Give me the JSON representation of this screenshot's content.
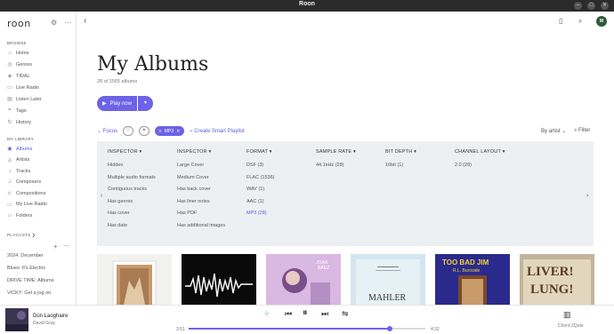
{
  "window": {
    "title": "Roon"
  },
  "sidebar": {
    "logo": "roon",
    "browse_label": "BROWSE",
    "browse_items": [
      {
        "label": "Home",
        "icon": "home-icon",
        "glyph": "⌂"
      },
      {
        "label": "Genres",
        "icon": "genres-icon",
        "glyph": "◎"
      },
      {
        "label": "TIDAL",
        "icon": "tidal-icon",
        "glyph": "◈"
      },
      {
        "label": "Live Radio",
        "icon": "radio-icon",
        "glyph": "▭"
      },
      {
        "label": "Listen Later",
        "icon": "listen-later-icon",
        "glyph": "▤"
      },
      {
        "label": "Tags",
        "icon": "tag-icon",
        "glyph": "⌖"
      },
      {
        "label": "History",
        "icon": "history-icon",
        "glyph": "↻"
      }
    ],
    "library_label": "MY LIBRARY",
    "library_items": [
      {
        "label": "Albums",
        "icon": "albums-icon",
        "glyph": "◉",
        "active": true
      },
      {
        "label": "Artists",
        "icon": "artists-icon",
        "glyph": "♙"
      },
      {
        "label": "Tracks",
        "icon": "tracks-icon",
        "glyph": "♪"
      },
      {
        "label": "Composers",
        "icon": "composers-icon",
        "glyph": "♫"
      },
      {
        "label": "Compositions",
        "icon": "compositions-icon",
        "glyph": "♬"
      },
      {
        "label": "My Live Radio",
        "icon": "my-live-radio-icon",
        "glyph": "▭"
      },
      {
        "label": "Folders",
        "icon": "folder-icon",
        "glyph": "▱"
      }
    ],
    "playlists_label": "PLAYLISTS ❯",
    "playlists": [
      "2024: December",
      "Blues: It's Electric",
      "DRIVE TIME: Albums",
      "VICKY: Get a jog on"
    ]
  },
  "header": {
    "title": "My Albums",
    "subtitle": "28 of 1565 albums",
    "play_now": "Play now",
    "avatar_initials": "M"
  },
  "toolbar": {
    "focus": "Focus",
    "chip_label": "MP3",
    "smart_playlist": "Create Smart Playlist",
    "sort": "By artist",
    "filter": "Filter"
  },
  "focus_panel": {
    "columns": [
      {
        "header": "INSPECTOR ▾",
        "values": [
          "Hidden",
          "Multiple audio formats",
          "Contiguous tracks",
          "Has genres",
          "Has cover",
          "Has date"
        ]
      },
      {
        "header": "INSPECTOR ▾",
        "values": [
          "Large Cover",
          "Medium Cover",
          "Has back cover",
          "Has liner notes",
          "Has PDF",
          "Has additional images"
        ]
      },
      {
        "header": "FORMAT ▾",
        "values": [
          "DSF (3)",
          "FLAC (1536)",
          "WAV (1)",
          "AAC (1)",
          "MP3 (28)"
        ]
      },
      {
        "header": "SAMPLE RATE ▾",
        "values": [
          "44.1kHz (28)"
        ]
      },
      {
        "header": "BIT DEPTH ▾",
        "values": [
          "16bit (1)"
        ]
      },
      {
        "header": "CHANNEL LAYOUT ▾",
        "values": [
          "2.0 (28)"
        ]
      }
    ],
    "selected_value": "MP3 (28)"
  },
  "albums": [
    {
      "name": "album-cover-1",
      "text": ""
    },
    {
      "name": "album-cover-2",
      "text": ""
    },
    {
      "name": "album-cover-3",
      "text": "JOAN BAEZ"
    },
    {
      "name": "album-cover-4",
      "text": "MAHLER"
    },
    {
      "name": "album-cover-5",
      "text": "TOO BAD JIM R.L. Burnside"
    },
    {
      "name": "album-cover-6",
      "text": "LIVER! LUNG!"
    }
  ],
  "now_playing": {
    "title": "Dún Laoghaire",
    "artist": "David Gray",
    "elapsed": "3:51",
    "duration": "4:32",
    "progress": 0.85,
    "zone": "Chord 2Qute"
  },
  "colors": {
    "accent": "#6c63e8",
    "panel": "#edf0f3"
  }
}
